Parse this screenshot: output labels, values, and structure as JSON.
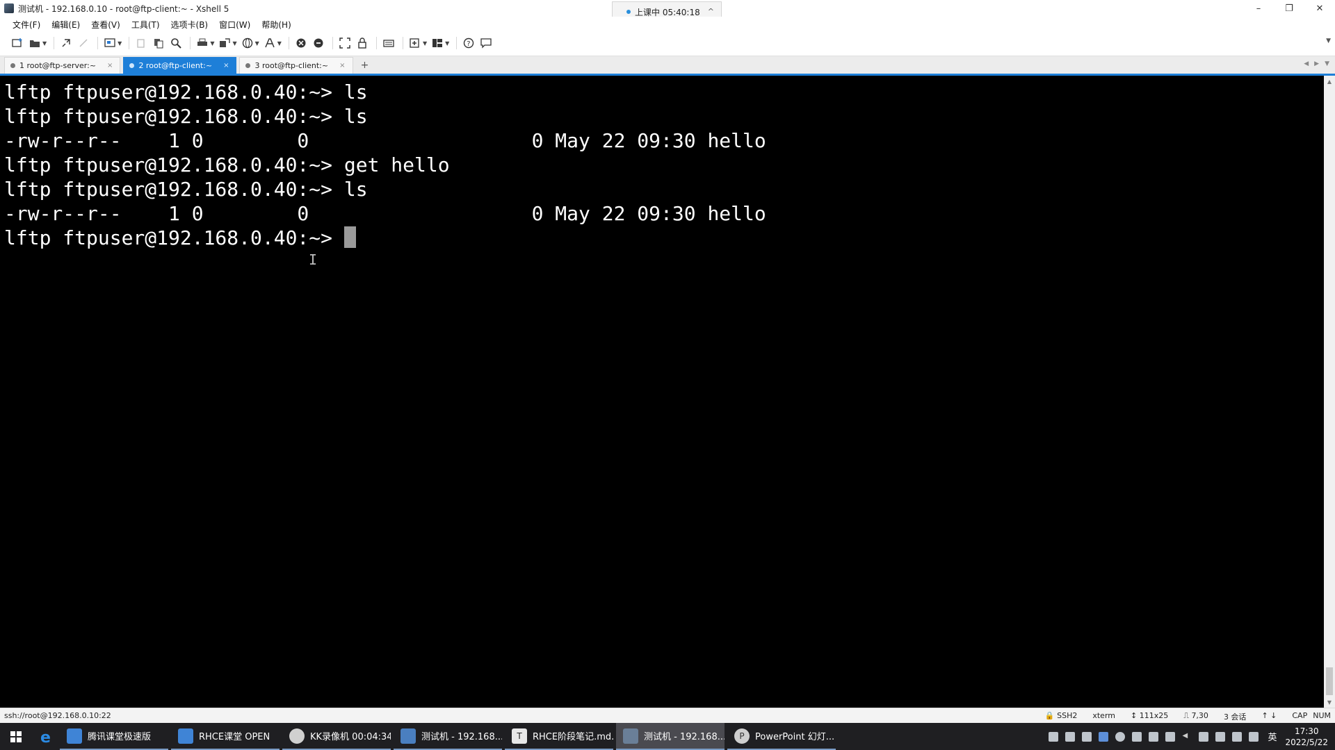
{
  "window": {
    "title": "测试机 - 192.168.0.10 - root@ftp-client:~ - Xshell 5",
    "minimize": "–",
    "restore": "❐",
    "close": "✕"
  },
  "class_badge": {
    "status": "上课中 05:40:18",
    "expand": "^"
  },
  "menu": [
    "文件(F)",
    "编辑(E)",
    "查看(V)",
    "工具(T)",
    "选项卡(B)",
    "窗口(W)",
    "帮助(H)"
  ],
  "toolbar": {
    "icons": [
      "new-session-icon",
      "open-folder-icon",
      "reconnect-icon",
      "disconnect-icon",
      "session-properties-icon",
      "copy-icon",
      "paste-icon",
      "find-icon",
      "print-icon",
      "transfer-icon",
      "globe-icon",
      "font-icon",
      "xftp-icon",
      "xftp2-icon",
      "fullscreen-icon",
      "lock-icon",
      "keyboard-icon",
      "add-icon",
      "layout-icon",
      "help-icon",
      "chat-icon"
    ]
  },
  "tabs": [
    {
      "label": "1 root@ftp-server:~",
      "active": false
    },
    {
      "label": "2 root@ftp-client:~",
      "active": true
    },
    {
      "label": "3 root@ftp-client:~",
      "active": false
    }
  ],
  "tab_add": "+",
  "terminal": {
    "lines": [
      "lftp ftpuser@192.168.0.40:~> ls",
      "lftp ftpuser@192.168.0.40:~> ls",
      "-rw-r--r--    1 0        0                   0 May 22 09:30 hello",
      "lftp ftpuser@192.168.0.40:~> get hello",
      "lftp ftpuser@192.168.0.40:~> ls",
      "-rw-r--r--    1 0        0                   0 May 22 09:30 hello",
      "lftp ftpuser@192.168.0.40:~> "
    ]
  },
  "statusbar": {
    "connection": "ssh://root@192.168.0.10:22",
    "protocol": "SSH2",
    "terminal_type": "xterm",
    "size": "111x25",
    "cursor_pos": "7,30",
    "sessions": "3 会话",
    "caps": "CAP",
    "num": "NUM"
  },
  "taskbar": {
    "items": [
      {
        "label": "腾讯课堂极速版",
        "active": false
      },
      {
        "label": "RHCE课堂 OPEN",
        "active": false
      },
      {
        "label": "KK录像机 00:04:34",
        "active": false
      },
      {
        "label": "测试机 - 192.168....",
        "active": false
      },
      {
        "label": "RHCE阶段笔记.md...",
        "active": false
      },
      {
        "label": "测试机 - 192.168....",
        "active": true
      },
      {
        "label": "PowerPoint 幻灯...",
        "active": false
      }
    ],
    "ime": "英",
    "time": "17:30",
    "date": "2022/5/22"
  }
}
